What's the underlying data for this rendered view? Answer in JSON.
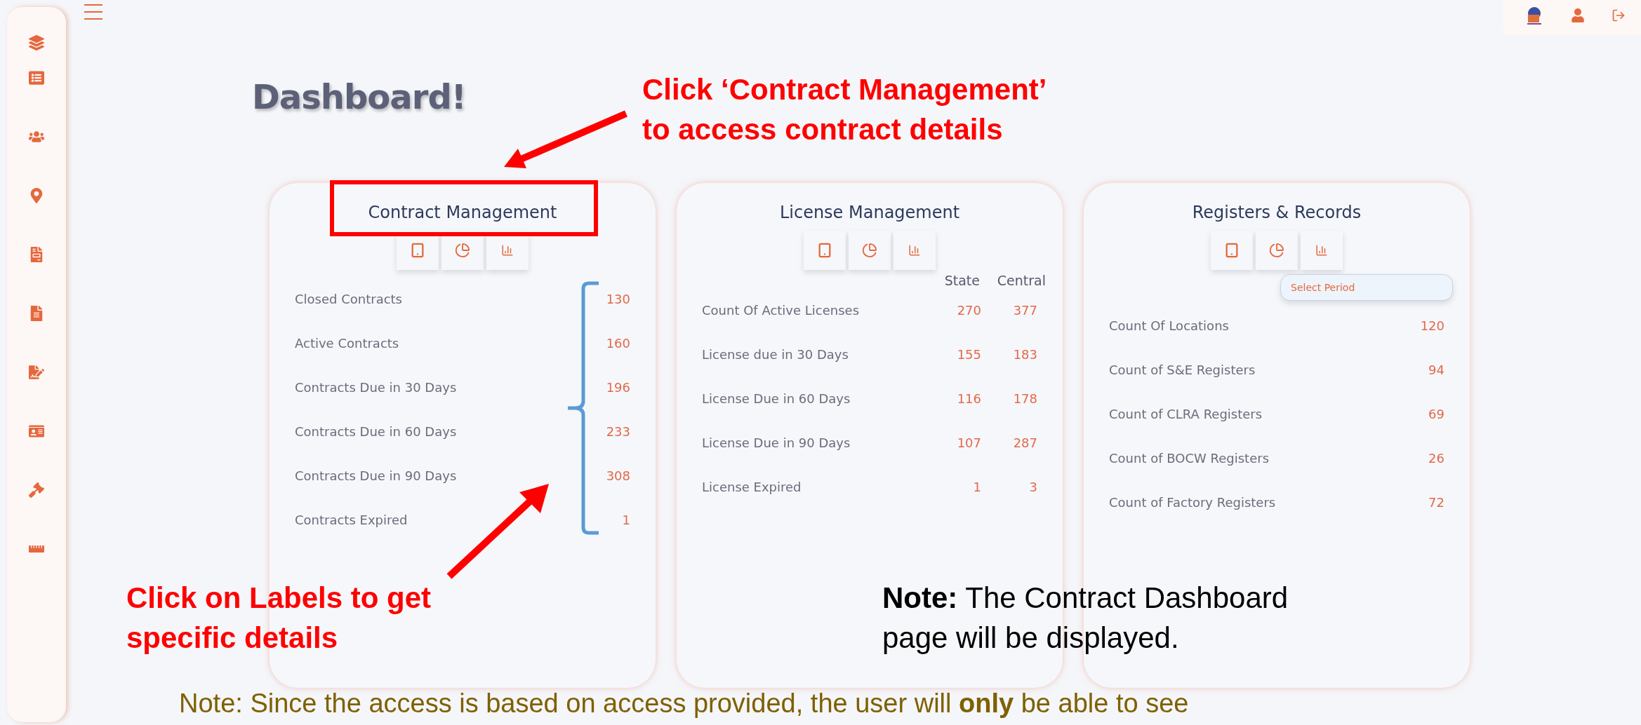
{
  "title": "Dashboard!",
  "cards": [
    {
      "title": "Contract Management",
      "rows": [
        {
          "label": "Closed Contracts",
          "values": [
            "130"
          ]
        },
        {
          "label": "Active Contracts",
          "values": [
            "160"
          ]
        },
        {
          "label": "Contracts Due in 30 Days",
          "values": [
            "196"
          ]
        },
        {
          "label": "Contracts Due in 60 Days",
          "values": [
            "233"
          ]
        },
        {
          "label": "Contracts Due in 90 Days",
          "values": [
            "308"
          ]
        },
        {
          "label": "Contracts Expired",
          "values": [
            "1"
          ]
        }
      ]
    },
    {
      "title": "License Management",
      "columns": [
        "State",
        "Central"
      ],
      "rows": [
        {
          "label": "Count Of Active Licenses",
          "values": [
            "270",
            "377"
          ]
        },
        {
          "label": "License due in 30 Days",
          "values": [
            "155",
            "183"
          ]
        },
        {
          "label": "License Due in 60 Days",
          "values": [
            "116",
            "178"
          ]
        },
        {
          "label": "License Due in 90 Days",
          "values": [
            "107",
            "287"
          ]
        },
        {
          "label": "License Expired",
          "values": [
            "1",
            "3"
          ]
        }
      ]
    },
    {
      "title": "Registers & Records",
      "period_select": {
        "placeholder": "Select Period"
      },
      "rows": [
        {
          "label": "Count Of Locations",
          "values": [
            "120"
          ]
        },
        {
          "label": "Count of S&E Registers",
          "values": [
            "94"
          ]
        },
        {
          "label": "Count of CLRA Registers",
          "values": [
            "69"
          ]
        },
        {
          "label": "Count of BOCW Registers",
          "values": [
            "26"
          ]
        },
        {
          "label": "Count of Factory Registers",
          "values": [
            "72"
          ]
        }
      ]
    }
  ],
  "annotations": [
    {
      "kind": "callout",
      "text": "Click ‘Contract Management’\nto access contract details"
    },
    {
      "kind": "callout",
      "text": "Click on Labels to get\nspecific details"
    },
    {
      "kind": "note",
      "text": "**Note:** The Contract Dashboard\npage will be displayed."
    },
    {
      "kind": "footnote",
      "text": "Note: Since the access is based on access provided, the user will **only** be able to see"
    }
  ]
}
